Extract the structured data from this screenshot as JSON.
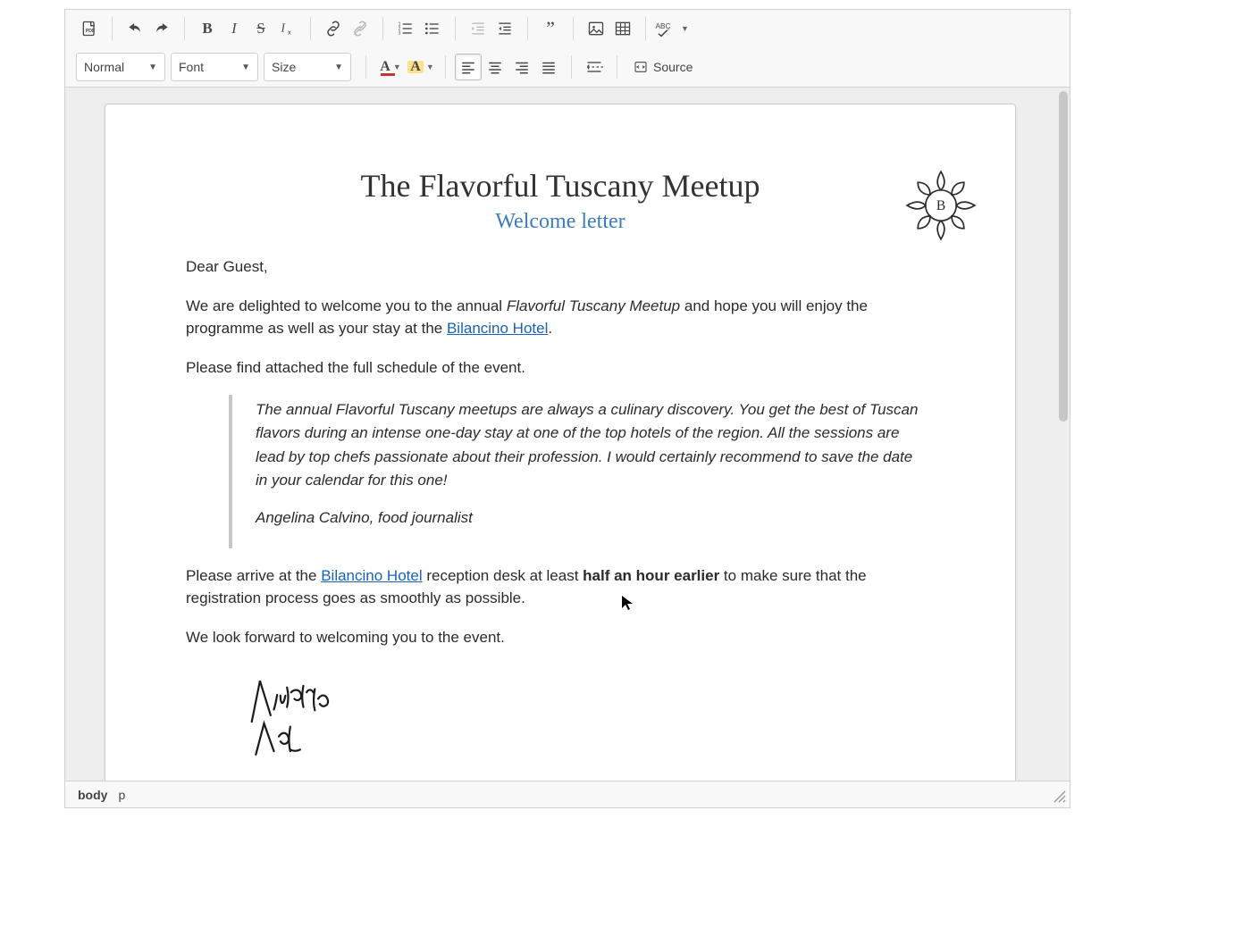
{
  "toolbar": {
    "format_combo": "Normal",
    "font_combo": "Font",
    "size_combo": "Size",
    "source_label": "Source"
  },
  "document": {
    "title": "The Flavorful Tuscany Meetup",
    "subtitle": "Welcome letter",
    "greeting": "Dear Guest,",
    "p1_a": "We are delighted to welcome you to the annual ",
    "p1_em": "Flavorful Tuscany Meetup",
    "p1_b": " and hope you will enjoy the programme as well as your stay at the ",
    "link1": "Bilancino Hotel",
    "p1_c": ".",
    "p2": "Please find attached the full schedule of the event.",
    "quote_body": "The annual Flavorful Tuscany meetups are always a culinary discovery. You get the best of Tuscan flavors during an intense one-day stay at one of the top hotels of the region. All the sessions are lead by top chefs passionate about their profession. I would certainly recommend to save the date in your calendar for this one!",
    "quote_attr": "Angelina Calvino, food journalist",
    "p3_a": "Please arrive at the ",
    "link2": "Bilancino Hotel",
    "p3_b": " reception desk at least ",
    "p3_strong": "half an hour earlier",
    "p3_c": " to make sure that the registration process goes as smoothly as possible.",
    "p4": "We look forward to welcoming you to the event.",
    "signature_name": "Victoria Vale"
  },
  "statusbar": {
    "path1": "body",
    "path2": "p"
  },
  "colors": {
    "link": "#1764b6",
    "subtitle": "#3b7bbf",
    "text_color_swatch": "#c0392b"
  }
}
